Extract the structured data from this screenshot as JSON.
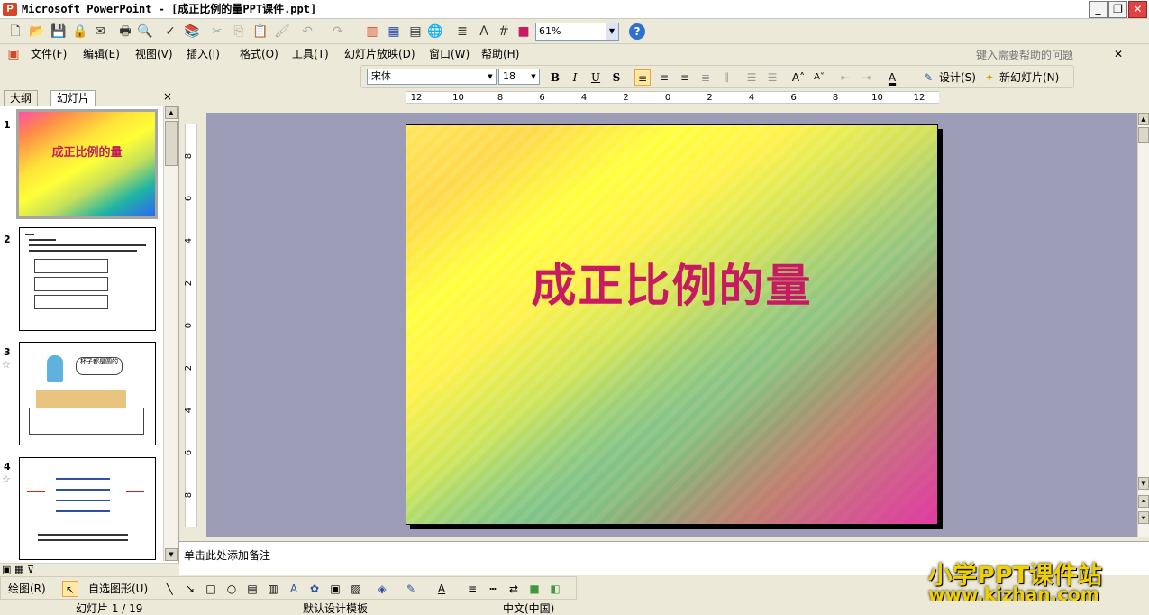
{
  "window": {
    "title": "Microsoft PowerPoint - [成正比例的量PPT课件.ppt]",
    "min": "_",
    "max": "❐",
    "close": "✕"
  },
  "standard_toolbar": {
    "zoom": "61%"
  },
  "menu": {
    "items": [
      "文件(F)",
      "编辑(E)",
      "视图(V)",
      "插入(I)",
      "格式(O)",
      "工具(T)",
      "幻灯片放映(D)",
      "窗口(W)",
      "帮助(H)"
    ],
    "help_search_placeholder": "键入需要帮助的问题"
  },
  "formatting_toolbar": {
    "font_name": "宋体",
    "font_size": "18",
    "bold": "B",
    "italic": "I",
    "underline": "U",
    "shadow": "S",
    "design_label": "设计(S)",
    "new_slide_label": "新幻灯片(N)"
  },
  "ruler": {
    "h_ticks": [
      "12",
      "10",
      "8",
      "6",
      "4",
      "2",
      "0",
      "2",
      "4",
      "6",
      "8",
      "10",
      "12"
    ],
    "v_ticks": [
      "8",
      "6",
      "4",
      "2",
      "0",
      "2",
      "4",
      "6",
      "8"
    ]
  },
  "left_pane": {
    "tab_outline": "大纲",
    "tab_slides": "幻灯片",
    "close": "×",
    "slide_numbers": [
      "1",
      "2",
      "3",
      "4"
    ],
    "thumb1_title": "成正比例的量",
    "thumb3_bubble": "杯子都是圆的"
  },
  "slide": {
    "title": "成正比例的量"
  },
  "notes": {
    "placeholder": "单击此处添加备注"
  },
  "drawing_toolbar": {
    "draw_label": "绘图(R)",
    "autoshapes_label": "自选图形(U)"
  },
  "watermark": {
    "line1": "小学PPT课件站",
    "line2": "www.kjzhan.com"
  },
  "statusbar": {
    "slide_pos": "幻灯片 1 / 19",
    "template": "默认设计模板",
    "language": "中文(中国)"
  }
}
